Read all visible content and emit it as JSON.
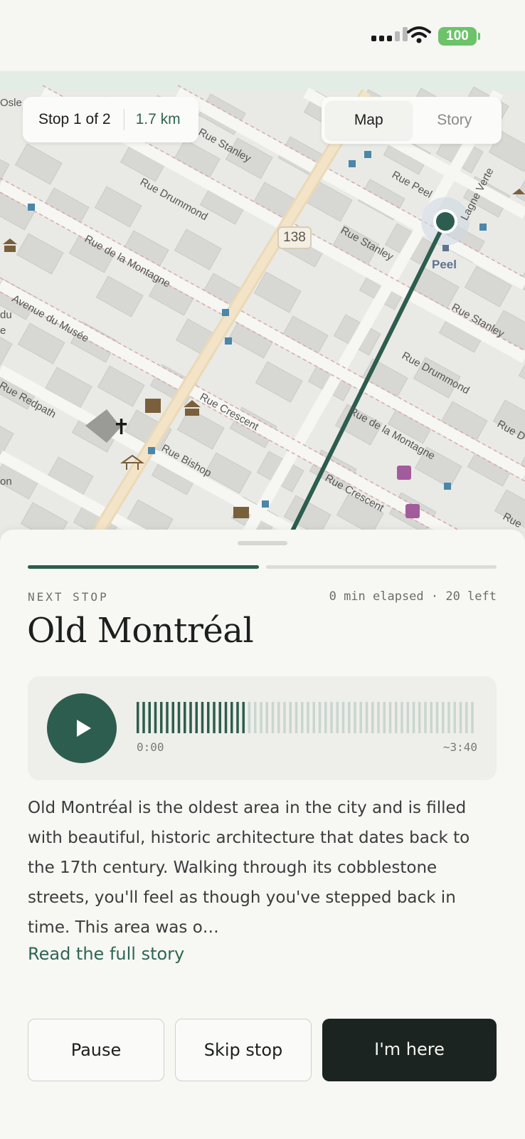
{
  "status_bar": {
    "battery": "100",
    "signal_icon": "signal-bars-icon",
    "wifi_icon": "wifi-icon"
  },
  "map": {
    "route_badge": "138",
    "station_label": "Peel",
    "street_labels": [
      "Rue Stanley",
      "Rue Drummond",
      "Rue de la Montagne",
      "Avenue du Musée",
      "Rue Peel",
      "Rue Stanley",
      "Rue Stanley",
      "Rue Drummond",
      "Rue de la Montagne",
      "Rue Crescent",
      "Rue Crescent",
      "Rue Bishop",
      "Rue Redpath",
      "Lagne Verte",
      "Osle",
      "du",
      "e",
      "on",
      "Rue D",
      "Rue"
    ],
    "route_color": "#2d5d4e",
    "stop_chip": {
      "count": "Stop 1 of 2",
      "distance": "1.7 km"
    },
    "view_toggle": {
      "map": "Map",
      "story": "Story",
      "selected": "Map"
    }
  },
  "sheet": {
    "progress": {
      "segments": 2,
      "current": 1
    },
    "eyebrow": "NEXT STOP",
    "elapsed": "0 min elapsed · 20 left",
    "title": "Old Montréal",
    "audio": {
      "icon": "play-icon",
      "current_time": "0:00",
      "duration": "~3:40",
      "played_fraction": 0.33
    },
    "description": "Old Montréal is the oldest area in the city and is filled with beautiful, historic architecture that dates back to the 17th century. Walking through its cobblestone streets, you'll feel as though you've stepped back in time. This area was o…",
    "read_more": "Read the full story",
    "actions": {
      "pause": "Pause",
      "skip": "Skip stop",
      "arrived": "I'm here"
    }
  }
}
